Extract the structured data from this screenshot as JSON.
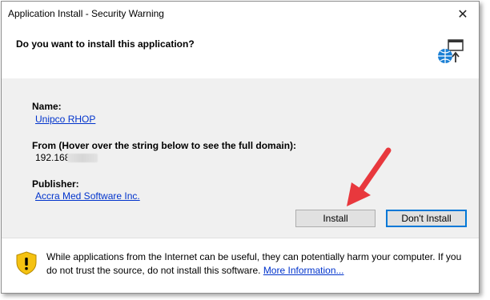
{
  "window": {
    "title": "Application Install - Security Warning",
    "close_glyph": "✕"
  },
  "header": {
    "question": "Do you want to install this application?",
    "icon": "application-install-icon"
  },
  "details": {
    "name_label": "Name:",
    "name_value": "Unipco RHOP",
    "from_label": "From (Hover over the string below to see the full domain):",
    "from_value": "192.168.",
    "publisher_label": "Publisher:",
    "publisher_value": "Accra Med Software Inc."
  },
  "buttons": {
    "install": "Install",
    "dont_install": "Don't Install"
  },
  "footer": {
    "warning_text": "While applications from the Internet can be useful, they can potentially harm your computer. If you do not trust the source, do not install this software.",
    "more_link": "More Information..."
  },
  "colors": {
    "link": "#0033cc",
    "annotation_arrow": "#e8383d",
    "focus_border": "#0078d7",
    "shield_yellow": "#f5c211"
  }
}
